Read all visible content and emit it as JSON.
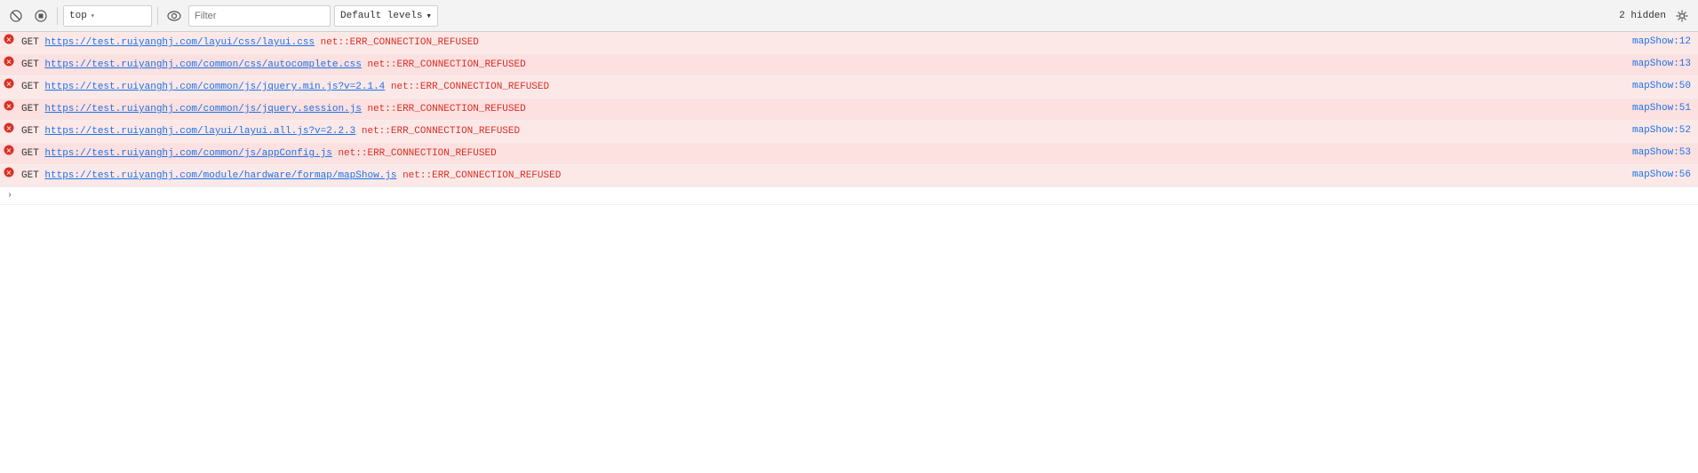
{
  "toolbar": {
    "context_selector": "top",
    "filter_placeholder": "Filter",
    "log_level_label": "Default levels",
    "hidden_count": "2 hidden",
    "clear_label": "Clear console",
    "stop_label": "Stop",
    "context_label": "top"
  },
  "console_rows": [
    {
      "id": 1,
      "type": "error",
      "method": "GET",
      "url": "https://test.ruiyanghj.com/layui/css/layui.css",
      "error": "net::ERR_CONNECTION_REFUSED",
      "source": "mapShow:12"
    },
    {
      "id": 2,
      "type": "error",
      "method": "GET",
      "url": "https://test.ruiyanghj.com/common/css/autocomplete.css",
      "error": "net::ERR_CONNECTION_REFUSED",
      "source": "mapShow:13"
    },
    {
      "id": 3,
      "type": "error",
      "method": "GET",
      "url": "https://test.ruiyanghj.com/common/js/jquery.min.js?v=2.1.4",
      "error": "net::ERR_CONNECTION_REFUSED",
      "source": "mapShow:50"
    },
    {
      "id": 4,
      "type": "error",
      "method": "GET",
      "url": "https://test.ruiyanghj.com/common/js/jquery.session.js",
      "error": "net::ERR_CONNECTION_REFUSED",
      "source": "mapShow:51"
    },
    {
      "id": 5,
      "type": "error",
      "method": "GET",
      "url": "https://test.ruiyanghj.com/layui/layui.all.js?v=2.2.3",
      "error": "net::ERR_CONNECTION_REFUSED",
      "source": "mapShow:52"
    },
    {
      "id": 6,
      "type": "error",
      "method": "GET",
      "url": "https://test.ruiyanghj.com/common/js/appConfig.js",
      "error": "net::ERR_CONNECTION_REFUSED",
      "source": "mapShow:53"
    },
    {
      "id": 7,
      "type": "error",
      "method": "GET",
      "url": "https://test.ruiyanghj.com/module/hardware/formap/mapShow.js",
      "error": "net::ERR_CONNECTION_REFUSED",
      "source": "mapShow:56"
    }
  ],
  "icons": {
    "clear": "🚫",
    "stop": "⊘",
    "chevron_down": "▾",
    "error_circle": "●",
    "settings": "⚙",
    "eye": "👁",
    "expand_arrow": "›"
  }
}
